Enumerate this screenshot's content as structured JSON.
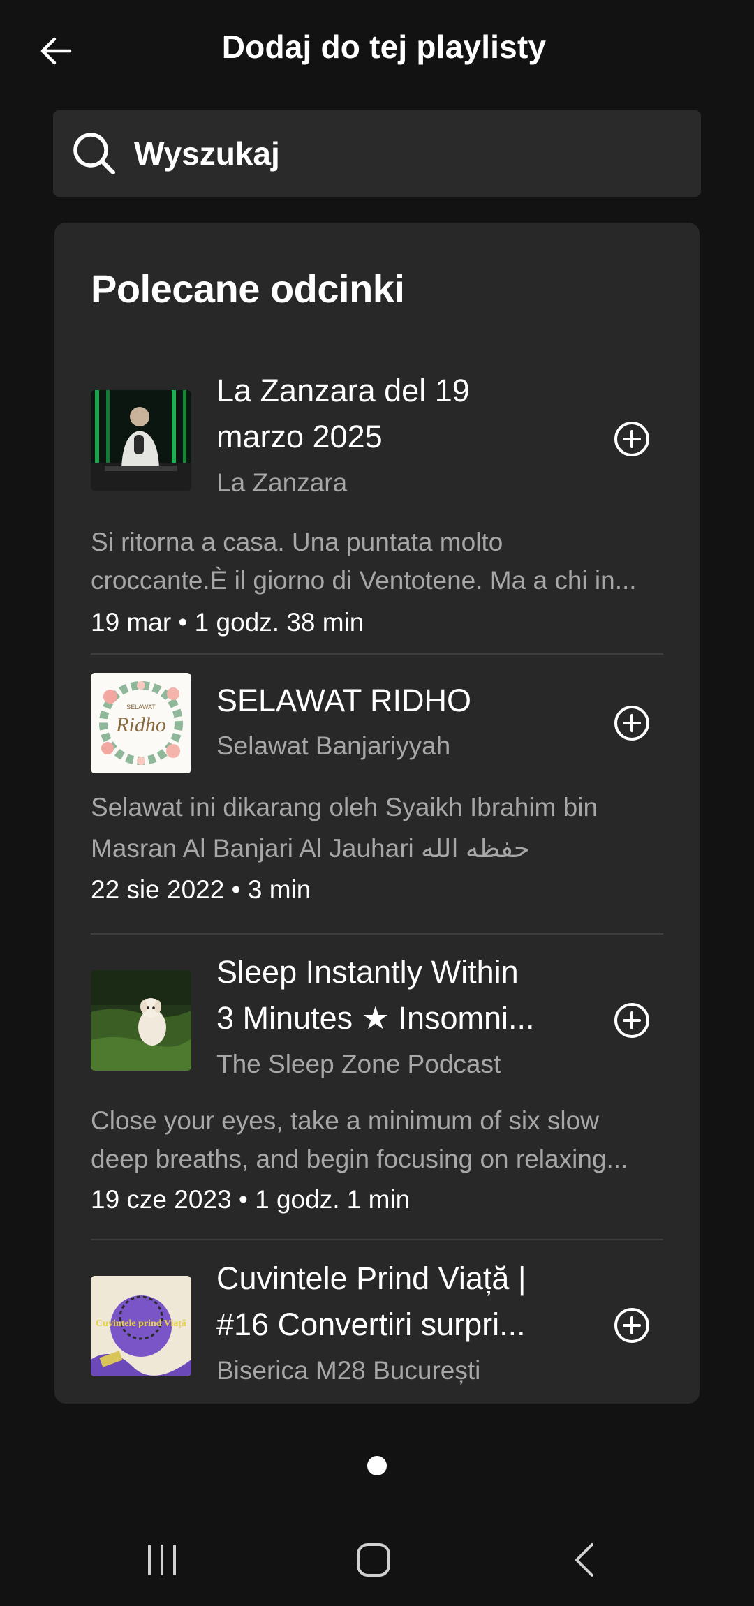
{
  "header": {
    "title": "Dodaj do tej playlisty",
    "back_icon": "arrow-left-icon"
  },
  "search": {
    "label": "Wyszukaj",
    "icon": "search-icon"
  },
  "recommended": {
    "title": "Polecane odcinki",
    "episodes": [
      {
        "title_line1": "La Zanzara del 19",
        "title_line2": "marzo 2025",
        "show": "La Zanzara",
        "desc_line1": "Si ritorna a casa. Una puntata molto",
        "desc_line2": "croccante.È il giorno di Ventotene. Ma a chi in...",
        "meta": "19 mar • 1 godz. 38 min"
      },
      {
        "title_line1": "SELAWAT RIDHO",
        "show": "Selawat Banjariyyah",
        "thumb_text_small": "SELAWAT",
        "thumb_text": "Ridho",
        "desc_line1": "Selawat ini dikarang oleh Syaikh Ibrahim bin",
        "desc_line2": "Masran Al Banjari Al Jauhari حفظه الله",
        "meta": "22 sie 2022 • 3 min"
      },
      {
        "title_line1": "Sleep Instantly Within",
        "title_line2": "3 Minutes ★ Insomni...",
        "show": "The Sleep Zone Podcast",
        "desc_line1": "Close your eyes, take a minimum of six slow",
        "desc_line2": "deep breaths, and begin focusing on relaxing...",
        "meta": "19 cze 2023 • 1 godz. 1 min"
      },
      {
        "title_line1": "Cuvintele Prind Viață |",
        "title_line2": "#16 Convertiri surpri...",
        "show": "Biserica M28 București",
        "thumb_text": "Cuvintele prind Viață"
      }
    ]
  },
  "colors": {
    "background": "#121212",
    "card": "#282828",
    "search": "#2a2a2a",
    "secondary_text": "#a7a7a7"
  }
}
